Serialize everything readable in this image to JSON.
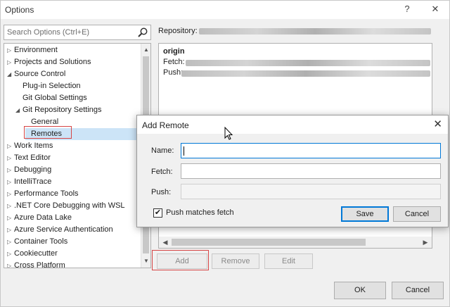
{
  "window": {
    "title": "Options",
    "help_glyph": "?",
    "close_glyph": "✕"
  },
  "search": {
    "placeholder": "Search Options (Ctrl+E)"
  },
  "tree": [
    {
      "label": "Environment",
      "arrow": "▷",
      "indent": 0
    },
    {
      "label": "Projects and Solutions",
      "arrow": "▷",
      "indent": 0
    },
    {
      "label": "Source Control",
      "arrow": "◢",
      "indent": 0
    },
    {
      "label": "Plug-in Selection",
      "arrow": "",
      "indent": 1
    },
    {
      "label": "Git Global Settings",
      "arrow": "",
      "indent": 1
    },
    {
      "label": "Git Repository Settings",
      "arrow": "◢",
      "indent": 1
    },
    {
      "label": "General",
      "arrow": "",
      "indent": 2
    },
    {
      "label": "Remotes",
      "arrow": "",
      "indent": 2,
      "selected": true
    },
    {
      "label": "Work Items",
      "arrow": "▷",
      "indent": 0
    },
    {
      "label": "Text Editor",
      "arrow": "▷",
      "indent": 0
    },
    {
      "label": "Debugging",
      "arrow": "▷",
      "indent": 0
    },
    {
      "label": "IntelliTrace",
      "arrow": "▷",
      "indent": 0
    },
    {
      "label": "Performance Tools",
      "arrow": "▷",
      "indent": 0
    },
    {
      "label": ".NET Core Debugging with WSL",
      "arrow": "▷",
      "indent": 0
    },
    {
      "label": "Azure Data Lake",
      "arrow": "▷",
      "indent": 0
    },
    {
      "label": "Azure Service Authentication",
      "arrow": "▷",
      "indent": 0
    },
    {
      "label": "Container Tools",
      "arrow": "▷",
      "indent": 0
    },
    {
      "label": "Cookiecutter",
      "arrow": "▷",
      "indent": 0
    },
    {
      "label": "Cross Platform",
      "arrow": "▷",
      "indent": 0
    }
  ],
  "repository": {
    "label": "Repository:"
  },
  "remote_list": {
    "name": "origin",
    "fetch_label": "Fetch:",
    "push_label": "Push:"
  },
  "list_buttons": {
    "add": "Add",
    "remove": "Remove",
    "edit": "Edit"
  },
  "footer": {
    "ok": "OK",
    "cancel": "Cancel"
  },
  "add_remote_dialog": {
    "title": "Add Remote",
    "close_glyph": "✕",
    "name_label": "Name:",
    "fetch_label": "Fetch:",
    "push_label": "Push:",
    "name_value": "",
    "fetch_value": "",
    "push_value": "",
    "push_matches_fetch_label": "Push matches fetch",
    "push_matches_fetch_checked": true,
    "check_glyph": "✔",
    "save": "Save",
    "cancel": "Cancel"
  },
  "colors": {
    "selection": "#cce4f7",
    "focus": "#0078d7",
    "highlight_box": "#d64545"
  }
}
